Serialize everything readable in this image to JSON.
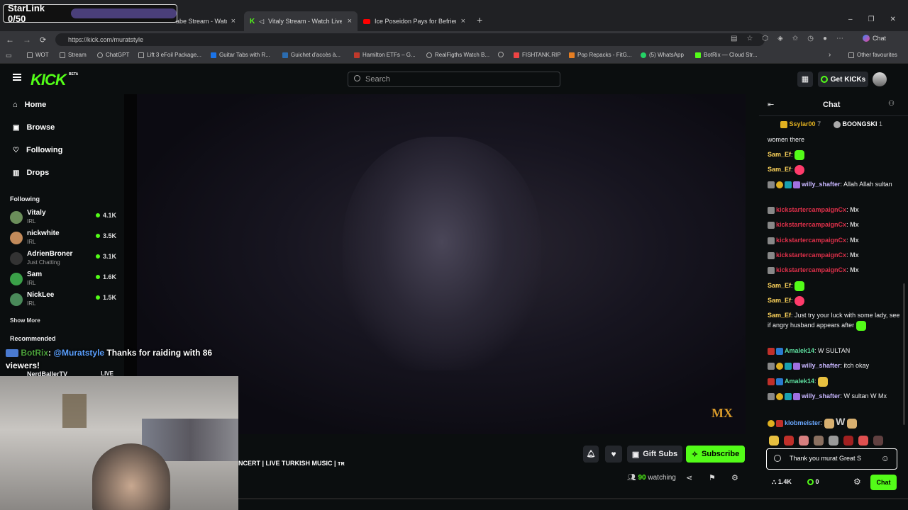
{
  "overlay": {
    "starlink": "StarLink 0/50"
  },
  "browser": {
    "tabs": [
      {
        "label": "abe Stream - Watch L"
      },
      {
        "label": "Vitaly Stream - Watch Live on"
      },
      {
        "label": "Ice Poseidon Pays for Befriending"
      }
    ],
    "url": "https://kick.com/muratstyle",
    "chat_button": "Chat",
    "bookmarks": [
      "WOT",
      "Stream",
      "ChatGPT",
      "Lift 3 eFoil Package...",
      "Guitar Tabs with R...",
      "Guichet d'accès à...",
      "Hamilton ETFs – G...",
      "RealFigths Watch B...",
      "FISHTANK.RIP",
      "Pop Repacks - FitG...",
      "(5) WhatsApp",
      "BotRix — Cloud Str...",
      "Other favourites"
    ]
  },
  "header": {
    "logo": "KICK",
    "logo_badge": "BETA",
    "search_placeholder": "Search",
    "get_kicks": "Get KICKs"
  },
  "sidebar": {
    "nav": [
      {
        "label": "Home",
        "icon": "home-icon"
      },
      {
        "label": "Browse",
        "icon": "browse-icon"
      },
      {
        "label": "Following",
        "icon": "heart-icon"
      },
      {
        "label": "Drops",
        "icon": "drops-icon"
      }
    ],
    "following_title": "Following",
    "following": [
      {
        "name": "Vitaly",
        "category": "IRL",
        "viewers": "4.1K",
        "color": "#6b8e5a"
      },
      {
        "name": "nickwhite",
        "category": "IRL",
        "viewers": "3.5K",
        "color": "#c28a5a"
      },
      {
        "name": "AdrienBroner",
        "category": "Just Chatting",
        "viewers": "3.1K",
        "color": "#222222"
      },
      {
        "name": "Sam",
        "category": "IRL",
        "viewers": "1.6K",
        "color": "#3aa048"
      },
      {
        "name": "NickLee",
        "category": "IRL",
        "viewers": "1.5K",
        "color": "#4a8a5a"
      }
    ],
    "show_more": "Show More",
    "recommended_title": "Recommended",
    "recommended": [
      {
        "name": "NerdBallerTV",
        "status": "LIVE"
      }
    ]
  },
  "raid_message": {
    "user": "BotRix",
    "mention": "@Muratstyle",
    "text": "Thanks for raiding with 86 viewers!"
  },
  "stream": {
    "title": "NCERT | LIVE TURKISH MUSIC | ᴛʀ",
    "watching_count": "90",
    "watching_label": "watching",
    "gift_subs": "Gift Subs",
    "subscribe": "Subscribe",
    "watermark": "MX"
  },
  "chat": {
    "title": "Chat",
    "pinned": [
      {
        "name": "Ssylar00",
        "count": "7"
      },
      {
        "name": "BOONGSKI",
        "count": "1"
      }
    ],
    "messages": [
      {
        "user": "",
        "text": "women there",
        "user_color": "#ffffff"
      },
      {
        "user": "Sam_Ef",
        "text": "",
        "user_color": "#ffd55c",
        "emote": "#53fc18"
      },
      {
        "user": "Sam_Ef",
        "text": "",
        "user_color": "#ffd55c",
        "emote": "#ff3b6b"
      },
      {
        "user": "willy_shafter",
        "text": "Allah Allah sultan",
        "user_color": "#c8b6ff"
      },
      {
        "user": "kickstartercampaignCx",
        "text": "Mx",
        "user_color": "#e0304a"
      },
      {
        "user": "kickstartercampaignCx",
        "text": "Mx",
        "user_color": "#e0304a"
      },
      {
        "user": "kickstartercampaignCx",
        "text": "Mx",
        "user_color": "#e0304a"
      },
      {
        "user": "kickstartercampaignCx",
        "text": "Mx",
        "user_color": "#e0304a"
      },
      {
        "user": "kickstartercampaignCx",
        "text": "Mx",
        "user_color": "#e0304a"
      },
      {
        "user": "Sam_Ef",
        "text": "",
        "user_color": "#ffd55c",
        "emote": "#53fc18"
      },
      {
        "user": "Sam_Ef",
        "text": "",
        "user_color": "#ffd55c",
        "emote": "#ff3b6b"
      },
      {
        "user": "Sam_Ef",
        "text": "Just try your luck with some lady, see if angry husband appears after",
        "user_color": "#ffd55c"
      },
      {
        "user": "Amalek14",
        "text": "W SULTAN",
        "user_color": "#5ee0a0"
      },
      {
        "user": "willy_shafter",
        "text": "itch okay",
        "user_color": "#c8b6ff"
      },
      {
        "user": "Amalek14",
        "text": "",
        "user_color": "#5ee0a0",
        "emote": "#e8c040"
      },
      {
        "user": "willy_shafter",
        "text": "W sultan W Mx",
        "user_color": "#c8b6ff"
      },
      {
        "user": "klobmeister",
        "text": "W",
        "user_color": "#6aa8ff"
      }
    ],
    "input_value": "Thank you murat Great S",
    "follower_count": "1.4K",
    "kicks_count": "0",
    "chat_button": "Chat"
  },
  "colors": {
    "accent": "#53fc18",
    "bg": "#0b0e0f"
  }
}
